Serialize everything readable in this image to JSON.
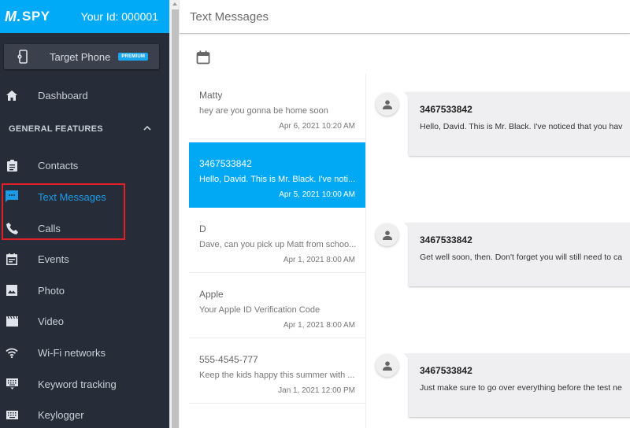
{
  "app": {
    "brand": "mSPY",
    "brand_prefix": "M.",
    "brand_suffix": "SPY",
    "user_id": "Your Id: 000001",
    "accent_color": "#01aaf6"
  },
  "target_phone": {
    "label": "Target Phone",
    "badge": "PREMIUM",
    "icon": "phone-settings-icon"
  },
  "sidebar": {
    "dashboard": {
      "label": "Dashboard",
      "icon": "home-icon"
    },
    "section_title": "GENERAL FEATURES",
    "items": [
      {
        "label": "Contacts",
        "icon": "clipboard-icon",
        "active": false
      },
      {
        "label": "Text Messages",
        "icon": "chat-icon",
        "active": true
      },
      {
        "label": "Calls",
        "icon": "phone-icon",
        "active": false
      },
      {
        "label": "Events",
        "icon": "calendar-event-icon",
        "active": false
      },
      {
        "label": "Photo",
        "icon": "image-icon",
        "active": false
      },
      {
        "label": "Video",
        "icon": "clapperboard-icon",
        "active": false
      },
      {
        "label": "Wi-Fi networks",
        "icon": "wifi-icon",
        "active": false
      },
      {
        "label": "Keyword tracking",
        "icon": "keyboard-hide-icon",
        "active": false
      },
      {
        "label": "Keylogger",
        "icon": "keyboard-icon",
        "active": false
      }
    ]
  },
  "main": {
    "title": "Text Messages",
    "messages": [
      {
        "name": "Matty",
        "preview": "hey are you gonna be home soon",
        "time": "Apr 6, 2021 10:20 AM",
        "selected": false
      },
      {
        "name": "3467533842",
        "preview": "Hello, David. This is Mr. Black. I've noti...",
        "time": "Apr 5, 2021 10:00 AM",
        "selected": true
      },
      {
        "name": "D",
        "preview": "Dave, can you pick up Matt from schoo...",
        "time": "Apr 1, 2021 8:00 AM",
        "selected": false
      },
      {
        "name": "Apple",
        "preview": "Your Apple ID Verification Code",
        "time": "Apr 1, 2021 8:00 AM",
        "selected": false
      },
      {
        "name": "555-4545-777",
        "preview": "Keep the kids happy this summer with ...",
        "time": "Jan 1, 2021 12:00 PM",
        "selected": false
      }
    ],
    "thread": [
      {
        "sender": "3467533842",
        "text": "Hello, David. This is Mr. Black. I've noticed that you hav"
      },
      {
        "sender": "3467533842",
        "text": "Get well soon, then. Don't forget you will still need to ca"
      },
      {
        "sender": "3467533842",
        "text": "Just make sure to go over everything before the test ne"
      }
    ]
  }
}
